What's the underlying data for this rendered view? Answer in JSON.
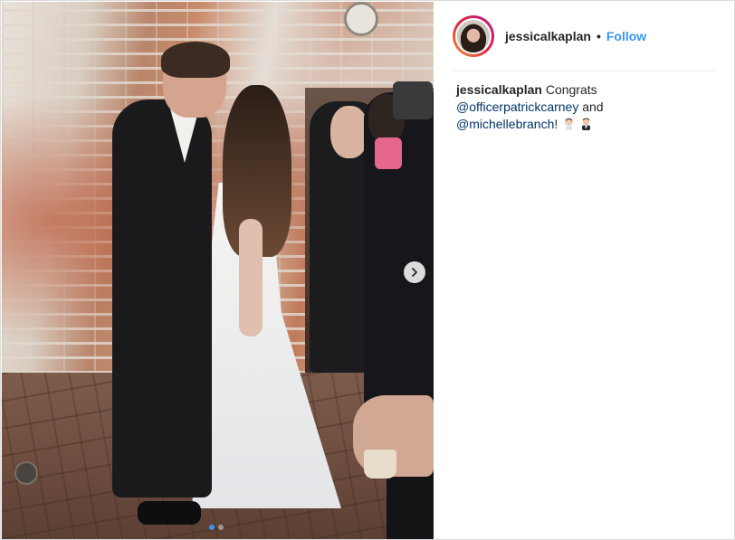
{
  "post": {
    "username": "jessicalkaplan",
    "bullet": "•",
    "follow_label": "Follow",
    "caption": {
      "username": "jessicalkaplan",
      "text_before": " Congrats ",
      "mention1": "@officerpatrickcarney",
      "text_middle": " and ",
      "mention2": "@michellebranch",
      "text_after": "!",
      "emojis": [
        "bride-emoji",
        "groom-emoji"
      ]
    }
  },
  "carousel": {
    "slide_count": 2,
    "active_index": 0,
    "next_icon": "chevron-right-icon"
  },
  "colors": {
    "accent_blue": "#3897f0",
    "mention_blue": "#003569",
    "text": "#262626",
    "border": "#dbdbdb"
  }
}
